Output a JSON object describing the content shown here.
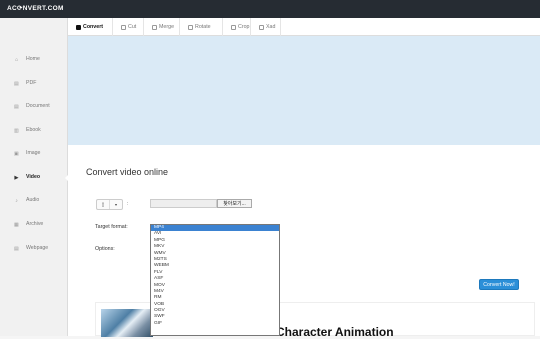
{
  "header": {
    "logo": "AC⟳NVERT.COM"
  },
  "sidebar": {
    "items": [
      {
        "label": "Home",
        "icon": "home-icon",
        "glyph": "⌂"
      },
      {
        "label": "PDF",
        "icon": "pdf-icon",
        "glyph": "▤"
      },
      {
        "label": "Document",
        "icon": "document-icon",
        "glyph": "▤"
      },
      {
        "label": "Ebook",
        "icon": "ebook-icon",
        "glyph": "▥"
      },
      {
        "label": "Image",
        "icon": "image-icon",
        "glyph": "▣"
      },
      {
        "label": "Video",
        "icon": "video-icon",
        "glyph": "▶"
      },
      {
        "label": "Audio",
        "icon": "audio-icon",
        "glyph": "♪"
      },
      {
        "label": "Archive",
        "icon": "archive-icon",
        "glyph": "▦"
      },
      {
        "label": "Webpage",
        "icon": "webpage-icon",
        "glyph": "▤"
      }
    ],
    "active": "Video"
  },
  "tabs": [
    {
      "label": "Convert",
      "active": true
    },
    {
      "label": "Cut",
      "active": false
    },
    {
      "label": "Merge",
      "active": false
    },
    {
      "label": "Rotate",
      "active": false
    },
    {
      "label": "Crop",
      "active": false
    },
    {
      "label": "Xad",
      "active": false
    }
  ],
  "main": {
    "heading": "Convert video online",
    "colon": ":",
    "browse_label": "찾아보기...",
    "target_format_label": "Target format:",
    "options_label": "Options:",
    "convert_button": "Convert Now!"
  },
  "format_dropdown": {
    "selected": "MP4",
    "options": [
      "MP4",
      "AVI",
      "MPG",
      "MKV",
      "WMV",
      "M2TS",
      "WEBM",
      "FLV",
      "ASF",
      "MOV",
      "M4V",
      "RM",
      "VOB",
      "OGV",
      "SWF",
      "GIF"
    ]
  },
  "ad": {
    "headline": "in Character Animation"
  },
  "colors": {
    "topbar": "#262c33",
    "banner": "#daeaf6",
    "accent": "#2b8fd8",
    "selected_option": "#3b82d1"
  }
}
